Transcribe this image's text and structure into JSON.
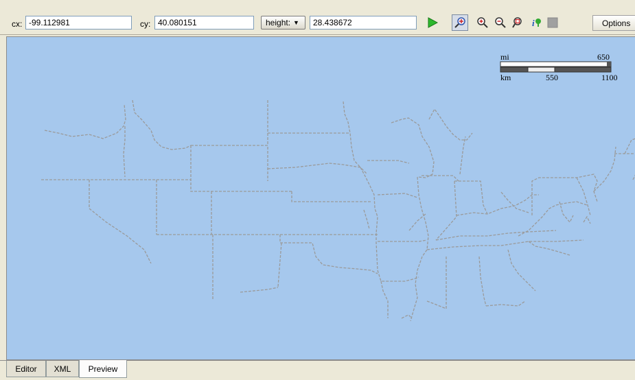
{
  "toolbar": {
    "cx_label": "cx:",
    "cx_value": "-99.112981",
    "cy_label": "cy:",
    "cy_value": "40.080151",
    "mode_select": "height:",
    "mode_value": "28.438672",
    "options_label": "Options",
    "icons": [
      "play-icon",
      "pan-icon",
      "zoom-in-icon",
      "zoom-out-icon",
      "zoom-rect-icon",
      "identify-icon",
      "stop-icon"
    ]
  },
  "map": {
    "scale_bar": {
      "top_unit": "mi",
      "top_max": "650",
      "bottom_unit": "km",
      "bottom_mid": "550",
      "bottom_max": "1100"
    },
    "background_color": "#a6c8ed",
    "boundary_color": "#9a9a9a"
  },
  "tabs": [
    {
      "label": "Editor",
      "active": false
    },
    {
      "label": "XML",
      "active": false
    },
    {
      "label": "Preview",
      "active": true
    }
  ]
}
